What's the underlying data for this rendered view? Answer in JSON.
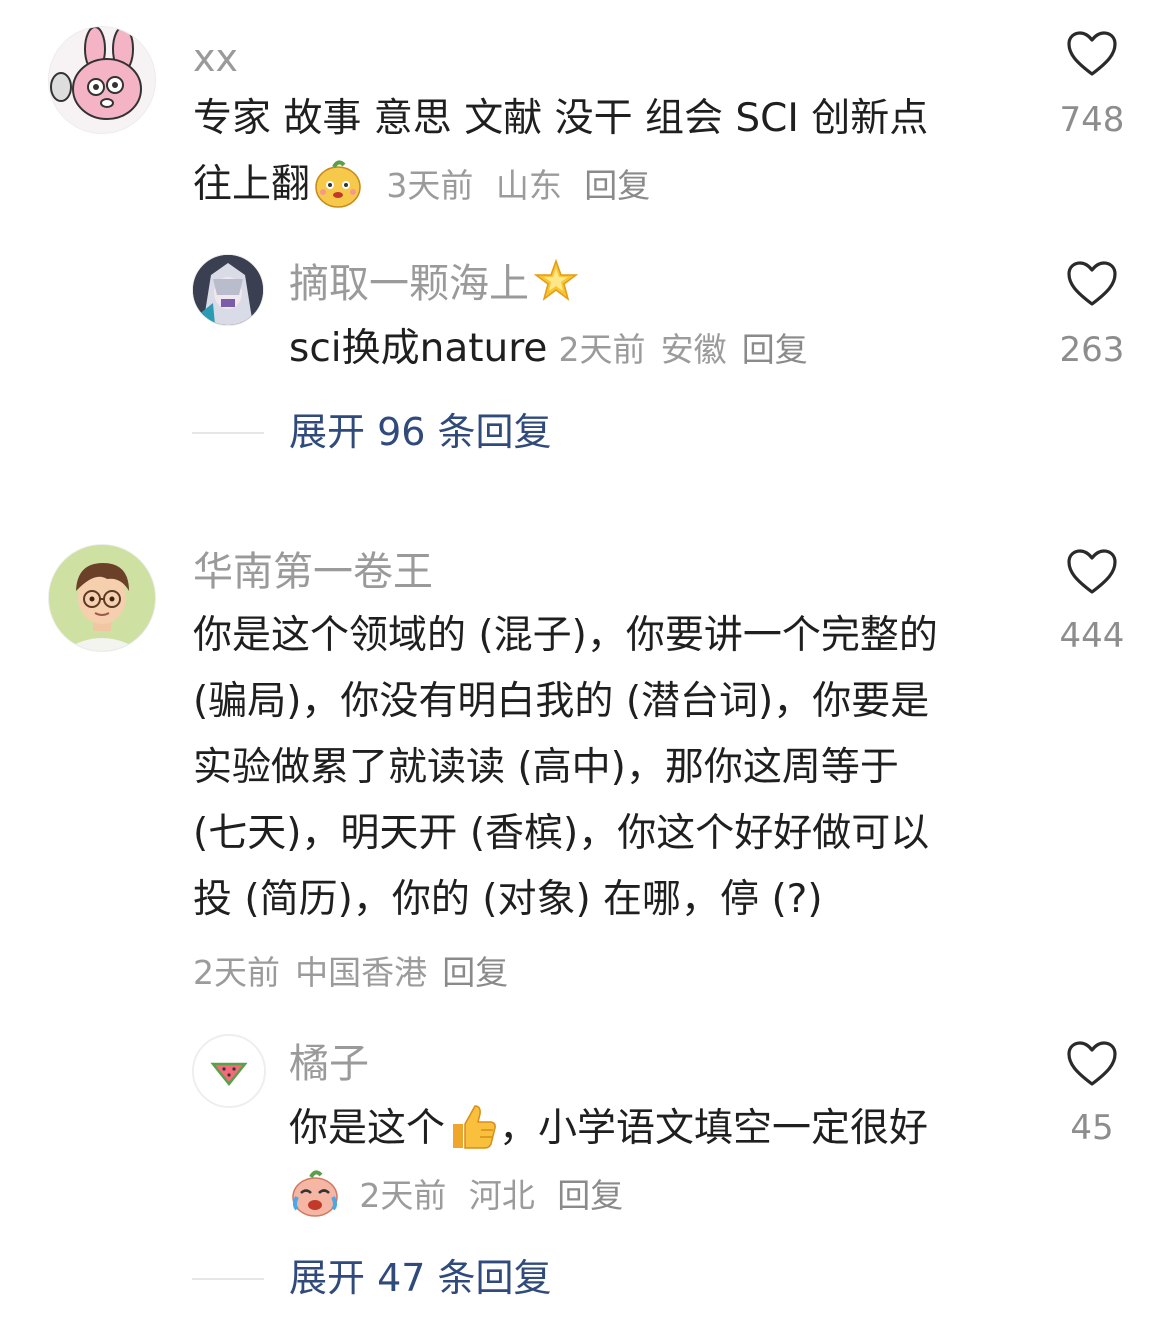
{
  "comments": [
    {
      "username": "xx",
      "text_line1": "专家 故事 意思 文献 没干 组会 SCI 创新点",
      "text_line2": "往上翻",
      "time": "3天前",
      "location": "山东",
      "reply": "回复",
      "likes": "748",
      "replies": [
        {
          "username": "摘取一颗海上",
          "text": "sci换成nature",
          "time": "2天前",
          "location": "安徽",
          "reply": "回复",
          "likes": "263"
        }
      ],
      "expand_label": "展开 96 条回复"
    },
    {
      "username": "华南第一卷王",
      "text_lines": [
        "你是这个领域的 (混子)，你要讲一个完整的",
        "(骗局)，你没有明白我的 (潜台词)，你要是",
        "实验做累了就读读 (高中)，那你这周等于",
        "(七天)，明天开 (香槟)，你这个好好做可以",
        "投 (简历)，你的 (对象) 在哪，停 (?)"
      ],
      "time": "2天前",
      "location": "中国香港",
      "reply": "回复",
      "likes": "444",
      "replies": [
        {
          "username": "橘子",
          "text_part1": "你是这个",
          "text_part2": "，小学语文填空一定很好",
          "time": "2天前",
          "location": "河北",
          "reply": "回复",
          "likes": "45"
        }
      ],
      "expand_label": "展开 47 条回复"
    }
  ],
  "icons": {
    "like": "heart-outline-icon",
    "emoji1": "smiling-mascot-emoji",
    "emoji2": "star-emoji",
    "emoji3": "thumbs-up-emoji",
    "emoji4": "crying-laughing-mascot-emoji",
    "avatar_melon": "watermelon-icon"
  },
  "colors": {
    "username": "#9a9a9a",
    "text": "#1f1f1f",
    "meta": "#9b9b9b",
    "expand": "#304a7c"
  }
}
